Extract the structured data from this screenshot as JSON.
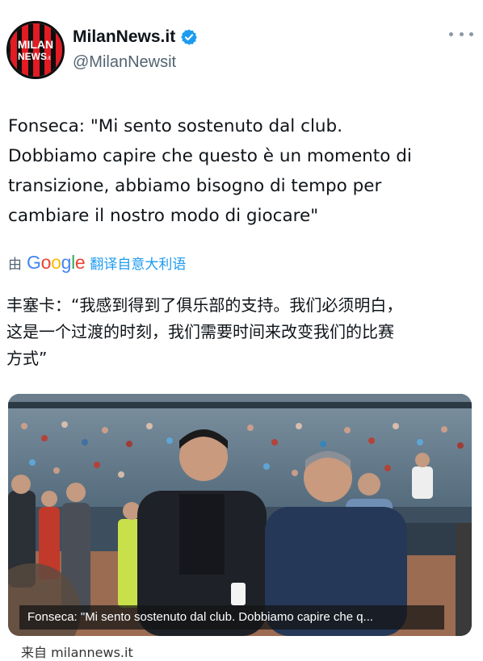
{
  "header": {
    "avatar_text_line1": "MILAN",
    "avatar_text_line2": "NEWS",
    "avatar_text_suffix": ".it",
    "display_name": "MilanNews.it",
    "handle": "@MilanNewsit",
    "verified_icon": "verified-badge-icon",
    "more_icon": "more-options-icon"
  },
  "tweet": {
    "lines": [
      "Fonseca: \"Mi sento sostenuto dal club.",
      "Dobbiamo capire che questo è un momento di",
      "transizione, abbiamo bisogno di tempo per",
      "cambiare il nostro modo di giocare\""
    ]
  },
  "translation": {
    "by_label": "由",
    "google_letters": [
      "G",
      "o",
      "o",
      "g",
      "l",
      "e"
    ],
    "translated_from": "翻译自意大利语",
    "lines": [
      "丰塞卡：“我感到得到了俱乐部的支持。我们必须明白，",
      "这是一个过渡的时刻，我们需要时间来改变我们的比赛",
      "方式”"
    ]
  },
  "media": {
    "caption": "Fonseca: \"Mi sento sostenuto dal club. Dobbiamo capire che q..."
  },
  "source": {
    "label": "来自 milannews.it"
  },
  "colors": {
    "accent_blue": "#1d9bf0",
    "milan_red": "#e31b23",
    "milan_black": "#0d0d0d",
    "text_primary": "#0f1419",
    "text_secondary": "#536471"
  }
}
